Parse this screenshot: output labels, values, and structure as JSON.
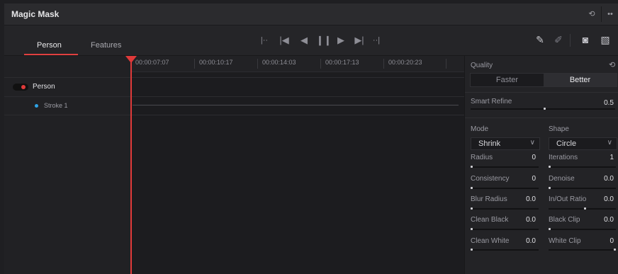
{
  "window": {
    "title": "Magic Mask"
  },
  "titlebar_icons": [
    "history-icon",
    "more-icon"
  ],
  "tabs": [
    {
      "label": "Person",
      "active": true
    },
    {
      "label": "Features",
      "active": false
    }
  ],
  "transport": [
    "mark-in-icon",
    "skip-back-icon",
    "play-reverse-icon",
    "pause-icon",
    "play-forward-icon",
    "skip-forward-icon",
    "mark-out-icon"
  ],
  "tools": [
    "add-stroke-icon",
    "subtract-stroke-icon",
    "show-mask-icon",
    "overlay-icon"
  ],
  "tracks": [
    {
      "label": "Person"
    },
    {
      "label": "Stroke 1"
    }
  ],
  "ruler": [
    "00:00:07:07",
    "00:00:10:17",
    "00:00:14:03",
    "00:00:17:13",
    "00:00:20:23"
  ],
  "inspector": {
    "quality": {
      "label": "Quality",
      "options": [
        "Faster",
        "Better"
      ],
      "selected": "Better"
    },
    "smart_refine": {
      "label": "Smart Refine",
      "value": "0.5"
    },
    "mode": {
      "label": "Mode",
      "value": "Shrink"
    },
    "shape": {
      "label": "Shape",
      "value": "Circle"
    },
    "left_params": [
      {
        "label": "Radius",
        "value": "0"
      },
      {
        "label": "Consistency",
        "value": "0"
      },
      {
        "label": "Blur Radius",
        "value": "0.0"
      },
      {
        "label": "Clean Black",
        "value": "0.0"
      },
      {
        "label": "Clean White",
        "value": "0.0"
      }
    ],
    "right_params": [
      {
        "label": "Iterations",
        "value": "1"
      },
      {
        "label": "Denoise",
        "value": "0.0"
      },
      {
        "label": "In/Out Ratio",
        "value": "0.0"
      },
      {
        "label": "Black Clip",
        "value": "0.0"
      },
      {
        "label": "White Clip",
        "value": "0"
      }
    ]
  },
  "colors": {
    "accent": "#e03a3a",
    "stroke": "#2ea3e6"
  }
}
